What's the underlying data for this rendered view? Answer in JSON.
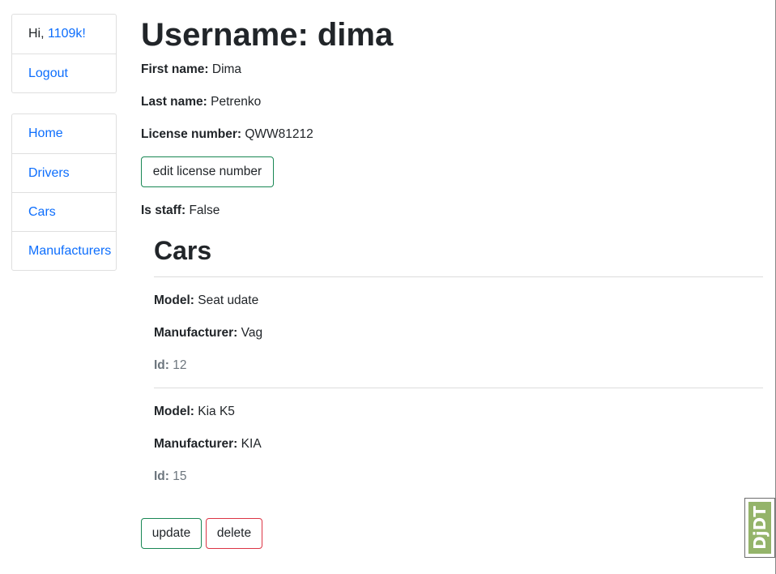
{
  "sidebar": {
    "user": {
      "greeting_prefix": "Hi, ",
      "username_link": "1109k!",
      "logout": "Logout"
    },
    "nav": [
      {
        "label": "Home"
      },
      {
        "label": "Drivers"
      },
      {
        "label": "Cars"
      },
      {
        "label": "Manufacturers"
      }
    ]
  },
  "driver": {
    "title": "Username: dima",
    "first_name": {
      "label": "First name:",
      "value": "Dima"
    },
    "last_name": {
      "label": "Last name:",
      "value": "Petrenko"
    },
    "license_number": {
      "label": "License number:",
      "value": "QWW81212"
    },
    "edit_license_button": "edit license number",
    "is_staff": {
      "label": "Is staff:",
      "value": "False"
    }
  },
  "cars": {
    "title": "Cars",
    "items": [
      {
        "model": {
          "label": "Model:",
          "value": "Seat udate"
        },
        "manufacturer": {
          "label": "Manufacturer:",
          "value": "Vag"
        },
        "id": {
          "label": "Id:",
          "value": "12"
        }
      },
      {
        "model": {
          "label": "Model:",
          "value": "Kia K5"
        },
        "manufacturer": {
          "label": "Manufacturer:",
          "value": "KIA"
        },
        "id": {
          "label": "Id:",
          "value": "15"
        }
      }
    ]
  },
  "actions": {
    "update": "update",
    "delete": "delete"
  },
  "debug_toolbar": {
    "label": "DjDT",
    "color": "#94b46a"
  },
  "colors": {
    "link": "#0d6efd",
    "success_border": "#198754",
    "danger_border": "#dc3545",
    "muted": "#6c757d"
  }
}
